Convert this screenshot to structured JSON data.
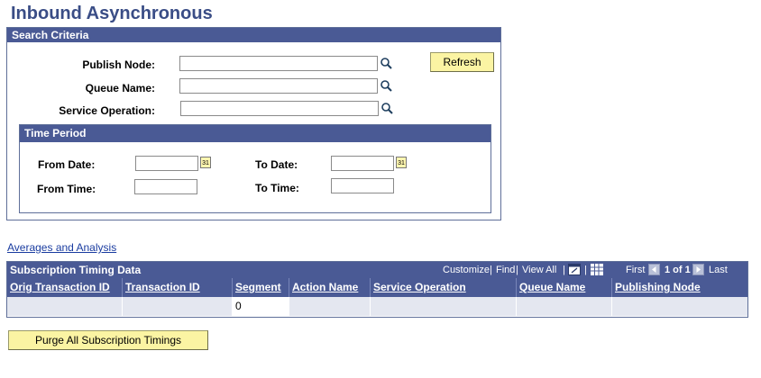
{
  "page": {
    "title": "Inbound Asynchronous"
  },
  "search": {
    "header": "Search Criteria",
    "publish_node_label": "Publish Node:",
    "queue_name_label": "Queue Name:",
    "service_operation_label": "Service Operation:",
    "publish_node_value": "",
    "queue_name_value": "",
    "service_operation_value": "",
    "refresh_label": "Refresh"
  },
  "time_period": {
    "header": "Time Period",
    "from_date_label": "From Date:",
    "to_date_label": "To Date:",
    "from_time_label": "From Time:",
    "to_time_label": "To Time:",
    "from_date_value": "",
    "to_date_value": "",
    "from_time_value": "",
    "to_time_value": "",
    "calendar_glyph": "31"
  },
  "links": {
    "averages": "Averages and Analysis"
  },
  "grid": {
    "title": "Subscription Timing Data",
    "customize": "Customize",
    "find": "Find",
    "view_all": "View All",
    "first": "First",
    "page_info": "1 of 1",
    "last": "Last",
    "sep": "|",
    "columns": [
      "Orig Transaction ID",
      "Transaction ID",
      "Segment",
      "Action Name",
      "Service Operation",
      "Queue Name",
      "Publishing Node"
    ],
    "rows": [
      [
        "",
        "",
        "0",
        "",
        "",
        "",
        ""
      ]
    ]
  },
  "purge": {
    "label": "Purge All Subscription Timings"
  },
  "icons": {
    "lookup": "magnifier-icon",
    "calendar": "calendar-icon",
    "new_window": "new-window-icon",
    "download": "download-grid-icon",
    "nav_first": "left-arrow-icon",
    "nav_last": "right-arrow-icon"
  },
  "colors": {
    "header_bg": "#4a5a95",
    "title_color": "#3a4d86",
    "button_bg": "#fbf4a3",
    "row_bg": "#e4e7f0",
    "link_color": "#1a3ca0"
  }
}
